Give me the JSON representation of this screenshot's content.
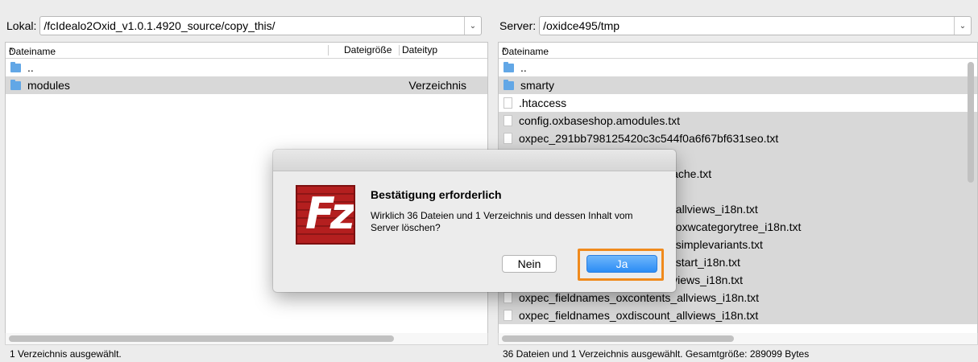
{
  "local": {
    "label": "Lokal:",
    "path": "/fcIdealo2Oxid_v1.0.1.4920_source/copy_this/",
    "columns": {
      "name": "Dateiname",
      "size": "Dateigröße",
      "type": "Dateityp"
    },
    "rows": [
      {
        "name": "..",
        "type": ""
      },
      {
        "name": "modules",
        "type": "Verzeichnis"
      }
    ],
    "status": "1 Verzeichnis ausgewählt."
  },
  "server": {
    "label": "Server:",
    "path": "/oxidce495/tmp",
    "columns": {
      "name": "Dateiname"
    },
    "rows": [
      {
        "name": ".."
      },
      {
        "name": "smarty"
      },
      {
        "name": ".htaccess"
      },
      {
        "name": "config.oxbaseshop.amodules.txt"
      },
      {
        "name": "oxpec_291bb798125420c3c544f0a6f67bf631seo.txt"
      },
      {
        "name": ""
      },
      {
        "name": "Cache.txt"
      },
      {
        "name": ""
      },
      {
        "name": "s_allviews_i18n.txt"
      },
      {
        "name": "s_oxwcategorytree_i18n.txt"
      },
      {
        "name": "s_simplevariants.txt"
      },
      {
        "name": "s_start_i18n.txt"
      },
      {
        "name": "ories_allviews_i18n.txt"
      },
      {
        "name": "oxpec_fieldnames_oxcontents_allviews_i18n.txt"
      },
      {
        "name": "oxpec_fieldnames_oxdiscount_allviews_i18n.txt"
      }
    ],
    "status": "36 Dateien und 1 Verzeichnis ausgewählt. Gesamtgröße: 289099 Bytes"
  },
  "dialog": {
    "title": "Bestätigung erforderlich",
    "message": "Wirklich 36 Dateien und 1 Verzeichnis und dessen Inhalt vom Server löschen?",
    "no_label": "Nein",
    "yes_label": "Ja"
  },
  "colors": {
    "accent": "#2b8cf5",
    "highlight": "#f08a1c",
    "logo": "#b41f1f"
  }
}
